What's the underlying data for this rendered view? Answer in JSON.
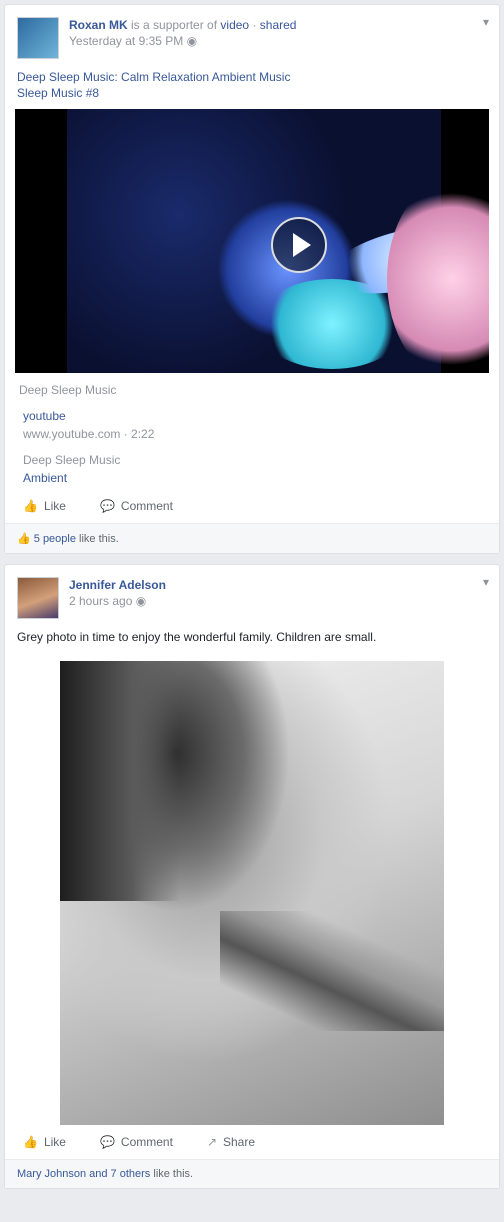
{
  "posts": [
    {
      "author": "Roxan MK",
      "action_text": "is a supporter of",
      "target1": "video",
      "target2": "shared",
      "time": "Yesterday at 9:35 PM",
      "caption": "Deep Sleep Music: Calm Relaxation Ambient Music",
      "caption_line2": "Sleep Music #8",
      "video_meta": "Deep Sleep Music",
      "source_link": "youtube",
      "source_site": "www.youtube.com · 2:22",
      "attach_note": "Deep Sleep Music",
      "attach_link": "Ambient",
      "actions": [
        "Like",
        "Comment"
      ],
      "footer_link": "5 people",
      "footer_text": "like this."
    },
    {
      "author": "Jennifer Adelson",
      "time": "2 hours ago",
      "text": "Grey photo in time to enjoy the wonderful family. Children are small.",
      "actions": [
        "Like",
        "Comment",
        "Share"
      ],
      "footer_link": "Mary Johnson and 7 others",
      "footer_text": "like this."
    }
  ],
  "icons": [
    "thumb-icon",
    "comment-icon",
    "share-icon",
    "globe-icon",
    "chevron-down-icon",
    "play-icon"
  ]
}
